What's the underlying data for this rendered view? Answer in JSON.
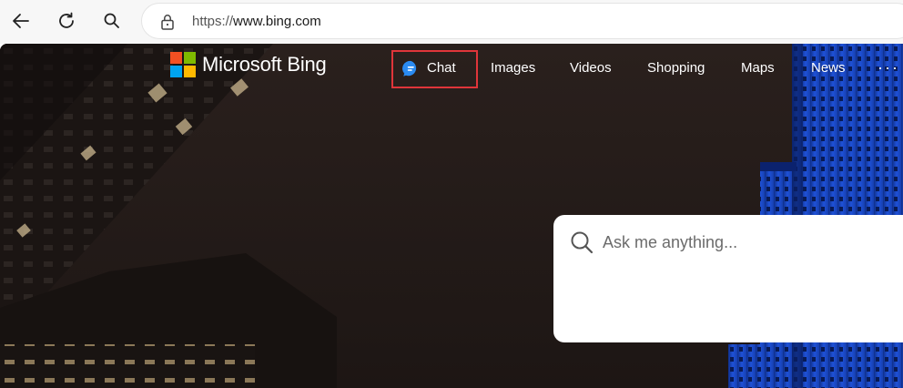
{
  "browser": {
    "url_scheme": "https://",
    "url_host": "www.bing.com",
    "icons": {
      "back": "arrow-left-icon",
      "reload": "refresh-icon",
      "search": "search-icon",
      "lock": "lock-icon"
    }
  },
  "brand": {
    "name": "Microsoft Bing",
    "logo_colors": [
      "#f25022",
      "#7fba00",
      "#00a4ef",
      "#ffb900"
    ]
  },
  "nav": {
    "chat": "Chat",
    "images": "Images",
    "videos": "Videos",
    "shopping": "Shopping",
    "maps": "Maps",
    "news": "News",
    "more": "···"
  },
  "search": {
    "placeholder": "Ask me anything..."
  },
  "colors": {
    "highlight": "#e0353a",
    "chat_icon": "#2a8bf2"
  }
}
